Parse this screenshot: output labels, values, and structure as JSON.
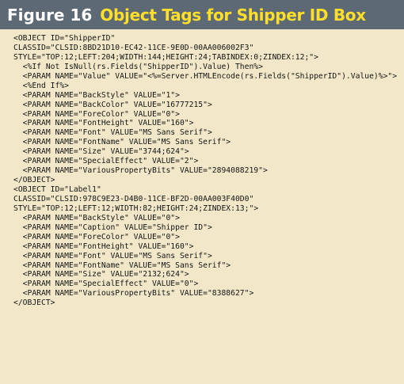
{
  "header": {
    "figure_label": "Figure 16",
    "title": "Object Tags for Shipper ID Box"
  },
  "code_lines": [
    "<OBJECT ID=\"ShipperID\"",
    "CLASSID=\"CLSID:8BD21D10-EC42-11CE-9E0D-00AA006002F3\"",
    "STYLE=\"TOP:12;LEFT:204;WIDTH:144;HEIGHT:24;TABINDEX:0;ZINDEX:12;\">",
    "  <%If Not IsNull(rs.Fields(\"ShipperID\").Value) Then%>",
    "  <PARAM NAME=\"Value\" VALUE=\"<%=Server.HTMLEncode(rs.Fields(\"ShipperID\").Value)%>\">",
    "  <%End If%>",
    "  <PARAM NAME=\"BackStyle\" VALUE=\"1\">",
    "  <PARAM NAME=\"BackColor\" VALUE=\"16777215\">",
    "  <PARAM NAME=\"ForeColor\" VALUE=\"0\">",
    "  <PARAM NAME=\"FontHeight\" VALUE=\"160\">",
    "  <PARAM NAME=\"Font\" VALUE=\"MS Sans Serif\">",
    "  <PARAM NAME=\"FontName\" VALUE=\"MS Sans Serif\">",
    "  <PARAM NAME=\"Size\" VALUE=\"3744;624\">",
    "  <PARAM NAME=\"SpecialEffect\" VALUE=\"2\">",
    "  <PARAM NAME=\"VariousPropertyBits\" VALUE=\"2894088219\">",
    "</OBJECT>",
    "<OBJECT ID=\"Label1\"",
    "CLASSID=\"CLSID:978C9E23-D4B0-11CE-BF2D-00AA003F40D0\"",
    "STYLE=\"TOP:12;LEFT:12;WIDTH:82;HEIGHT:24;ZINDEX:13;\">",
    "  <PARAM NAME=\"BackStyle\" VALUE=\"0\">",
    "  <PARAM NAME=\"Caption\" VALUE=\"Shipper ID\">",
    "  <PARAM NAME=\"ForeColor\" VALUE=\"0\">",
    "  <PARAM NAME=\"FontHeight\" VALUE=\"160\">",
    "  <PARAM NAME=\"Font\" VALUE=\"MS Sans Serif\">",
    "  <PARAM NAME=\"FontName\" VALUE=\"MS Sans Serif\">",
    "  <PARAM NAME=\"Size\" VALUE=\"2132;624\">",
    "  <PARAM NAME=\"SpecialEffect\" VALUE=\"0\">",
    "  <PARAM NAME=\"VariousPropertyBits\" VALUE=\"8388627\">",
    "</OBJECT>"
  ],
  "colors": {
    "header_background": "#5d6a76",
    "figure_label": "#ffffff",
    "title": "#ffdf2a",
    "page_background": "#f2e8c9",
    "code_text": "#141414"
  }
}
